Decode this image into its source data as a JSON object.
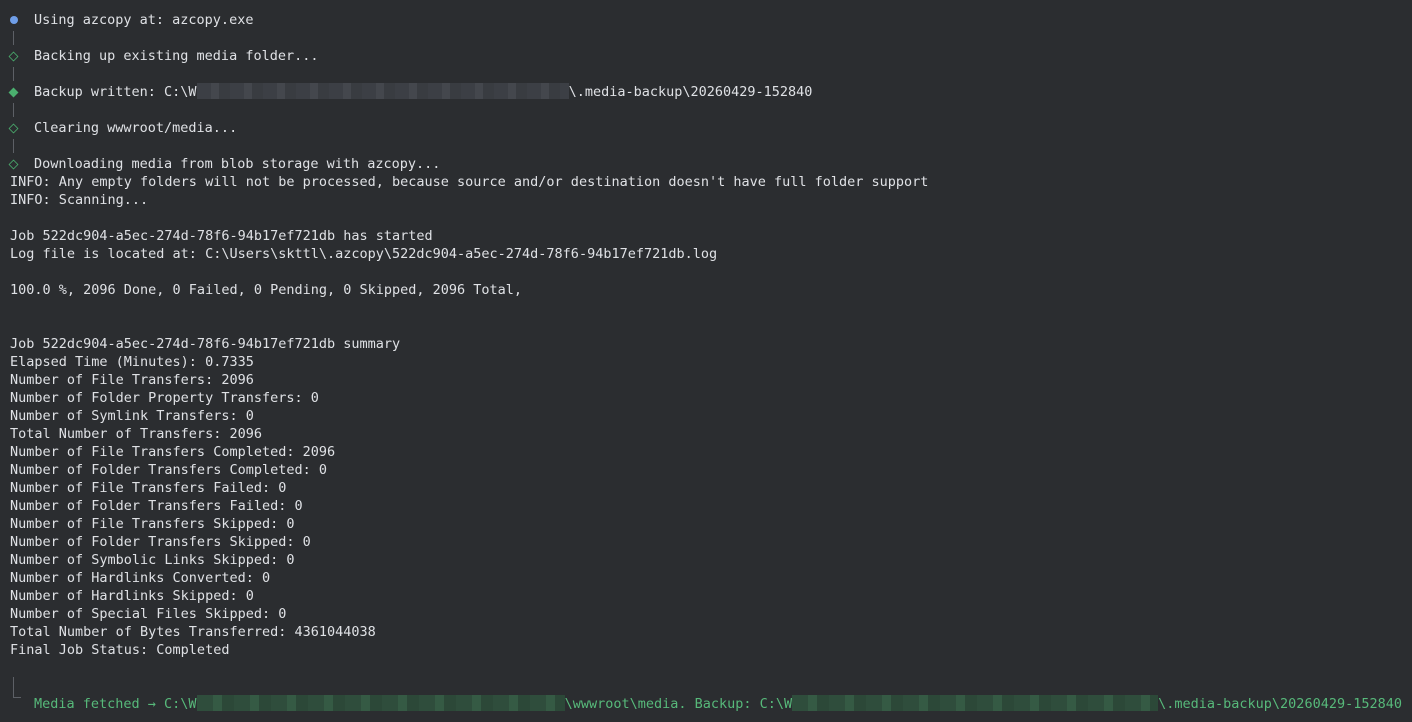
{
  "colors": {
    "background": "#2b2d30",
    "text": "#dfe1e5",
    "accent_green": "#57b97a",
    "info_dot": "#6f9ee8"
  },
  "steps": [
    {
      "icon": "info-dot-icon",
      "text": "Using azcopy at: azcopy.exe"
    },
    {
      "icon": "diamond-outline-icon",
      "text": "Backing up existing media folder..."
    },
    {
      "icon": "diamond-filled-icon",
      "prefix": "Backup written: C:\\W",
      "suffix": "\\.media-backup\\20260429-152840"
    },
    {
      "icon": "diamond-outline-icon",
      "text": "Clearing wwwroot/media..."
    },
    {
      "icon": "diamond-outline-icon",
      "text": "Downloading media from blob storage with azcopy..."
    }
  ],
  "log_lines": [
    "INFO: Any empty folders will not be processed, because source and/or destination doesn't have full folder support",
    "INFO: Scanning...",
    "",
    "Job 522dc904-a5ec-274d-78f6-94b17ef721db has started",
    "Log file is located at: C:\\Users\\skttl\\.azcopy\\522dc904-a5ec-274d-78f6-94b17ef721db.log",
    "",
    "100.0 %, 2096 Done, 0 Failed, 0 Pending, 0 Skipped, 2096 Total,",
    "",
    "",
    "Job 522dc904-a5ec-274d-78f6-94b17ef721db summary",
    "Elapsed Time (Minutes): 0.7335",
    "Number of File Transfers: 2096",
    "Number of Folder Property Transfers: 0",
    "Number of Symlink Transfers: 0",
    "Total Number of Transfers: 2096",
    "Number of File Transfers Completed: 2096",
    "Number of Folder Transfers Completed: 0",
    "Number of File Transfers Failed: 0",
    "Number of Folder Transfers Failed: 0",
    "Number of File Transfers Skipped: 0",
    "Number of Folder Transfers Skipped: 0",
    "Number of Symbolic Links Skipped: 0",
    "Number of Hardlinks Converted: 0",
    "Number of Hardlinks Skipped: 0",
    "Number of Special Files Skipped: 0",
    "Total Number of Bytes Transferred: 4361044038",
    "Final Job Status: Completed"
  ],
  "final_message": {
    "part1": "Media fetched → C:\\W",
    "part2": "\\wwwroot\\media. Backup: C:\\W",
    "part3": "\\.media-backup\\20260429-152840"
  }
}
